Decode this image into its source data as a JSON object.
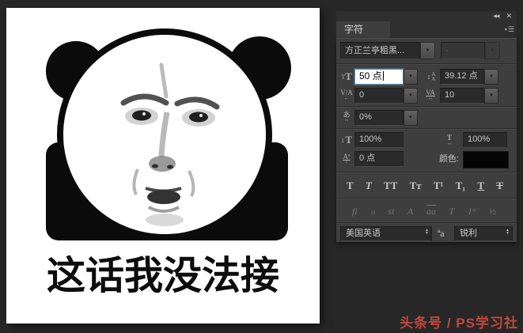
{
  "theme": {
    "window_bg": "#272727",
    "panel_bg": "#3e3e3e",
    "field_bg": "#2a2a2a",
    "text_color": "#c8c8c8",
    "focus_border": "#5b7f9e",
    "swatch_color": "#050505",
    "watermark_color": "#c0483e"
  },
  "canvas": {
    "caption": "这话我没法接"
  },
  "panel": {
    "header": {
      "collapse_icon": "◀◀",
      "close_icon": "✕",
      "tab": "字符",
      "menu_arrow": "▾",
      "menu_lines": "☰"
    },
    "font_family": "方正兰亭粗黑...",
    "font_style": "-",
    "fields": {
      "size": "50 点",
      "leading": "39.12 点",
      "kerning": "0",
      "tracking": "10",
      "tsume": "0%",
      "vertical_scale": "100%",
      "horizontal_scale": "100%",
      "baseline": "0 点"
    },
    "color_label": "颜色:",
    "icons": {
      "dropdown": "▼",
      "spin_up": "▲",
      "spin_down": "▼",
      "size_small": "T",
      "size_big": "T",
      "leading_arrow": "↕",
      "leading_a": "A",
      "kerning_main": "V/A",
      "kerning_arrow": "←",
      "tracking_main": "VA",
      "tracking_arrow": "↔",
      "tsume_main": "あ",
      "tsume_arrow": "↔",
      "vscale_arrow": "↕",
      "vscale_t": "T",
      "hscale_t": "T",
      "hscale_arrow": "↔",
      "baseline_main": "Aª",
      "baseline_arrow": "↑",
      "antialias": "ªa"
    },
    "style_buttons": [
      {
        "name": "faux-bold",
        "glyph": "T"
      },
      {
        "name": "faux-italic",
        "glyph": "T"
      },
      {
        "name": "all-caps",
        "glyph": "TT"
      },
      {
        "name": "small-caps",
        "glyph": "Tᴛ"
      },
      {
        "name": "superscript",
        "glyph": "T¹"
      },
      {
        "name": "subscript",
        "glyph": "T₁"
      },
      {
        "name": "underline",
        "glyph": "T"
      },
      {
        "name": "strikethrough",
        "glyph": "T"
      }
    ],
    "opentype_buttons": [
      "fi",
      "ℴ",
      "st",
      "A",
      "aa",
      "T",
      "1ˢᵗ",
      "½"
    ],
    "language": "美国英语",
    "antialias": "锐利"
  },
  "watermark": {
    "text": "头条号 / PS学习社"
  }
}
